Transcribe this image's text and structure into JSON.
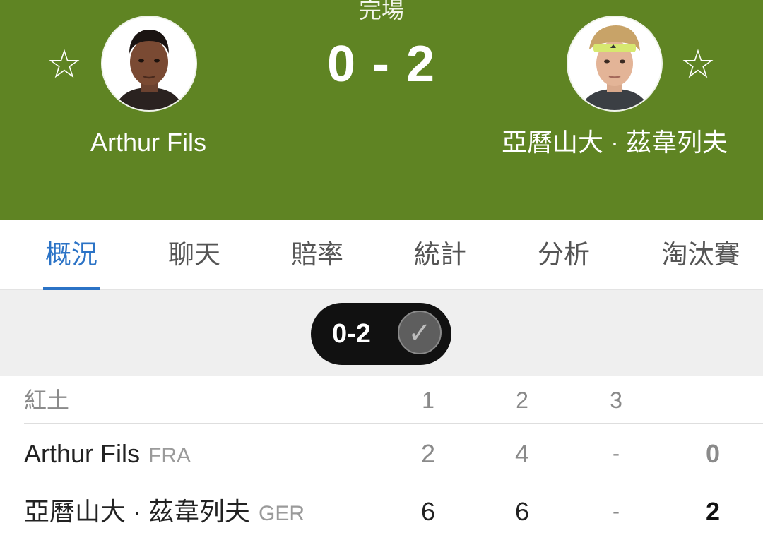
{
  "match": {
    "status": "完場",
    "score": "0 - 2"
  },
  "players": [
    {
      "name": "Arthur Fils",
      "country": "FRA",
      "favorite_icon": "star-outline-icon",
      "sets": [
        "2",
        "4",
        "-"
      ],
      "total": "0"
    },
    {
      "name": "亞曆山大 · 茲韋列夫",
      "country": "GER",
      "favorite_icon": "star-outline-icon",
      "sets": [
        "6",
        "6",
        "-"
      ],
      "total": "2"
    }
  ],
  "tabs": [
    {
      "label": "概況",
      "active": true
    },
    {
      "label": "聊天",
      "active": false
    },
    {
      "label": "賠率",
      "active": false
    },
    {
      "label": "統計",
      "active": false
    },
    {
      "label": "分析",
      "active": false
    },
    {
      "label": "淘汰賽",
      "active": false
    }
  ],
  "set_filter": {
    "label": "0-2",
    "icon": "checkmark-icon"
  },
  "score_table": {
    "surface": "紅土",
    "set_headers": [
      "1",
      "2",
      "3"
    ]
  },
  "colors": {
    "header_bg": "#5f8423",
    "active_tab": "#2b73c6",
    "band_bg": "#efefef",
    "pill_bg": "#111111"
  }
}
